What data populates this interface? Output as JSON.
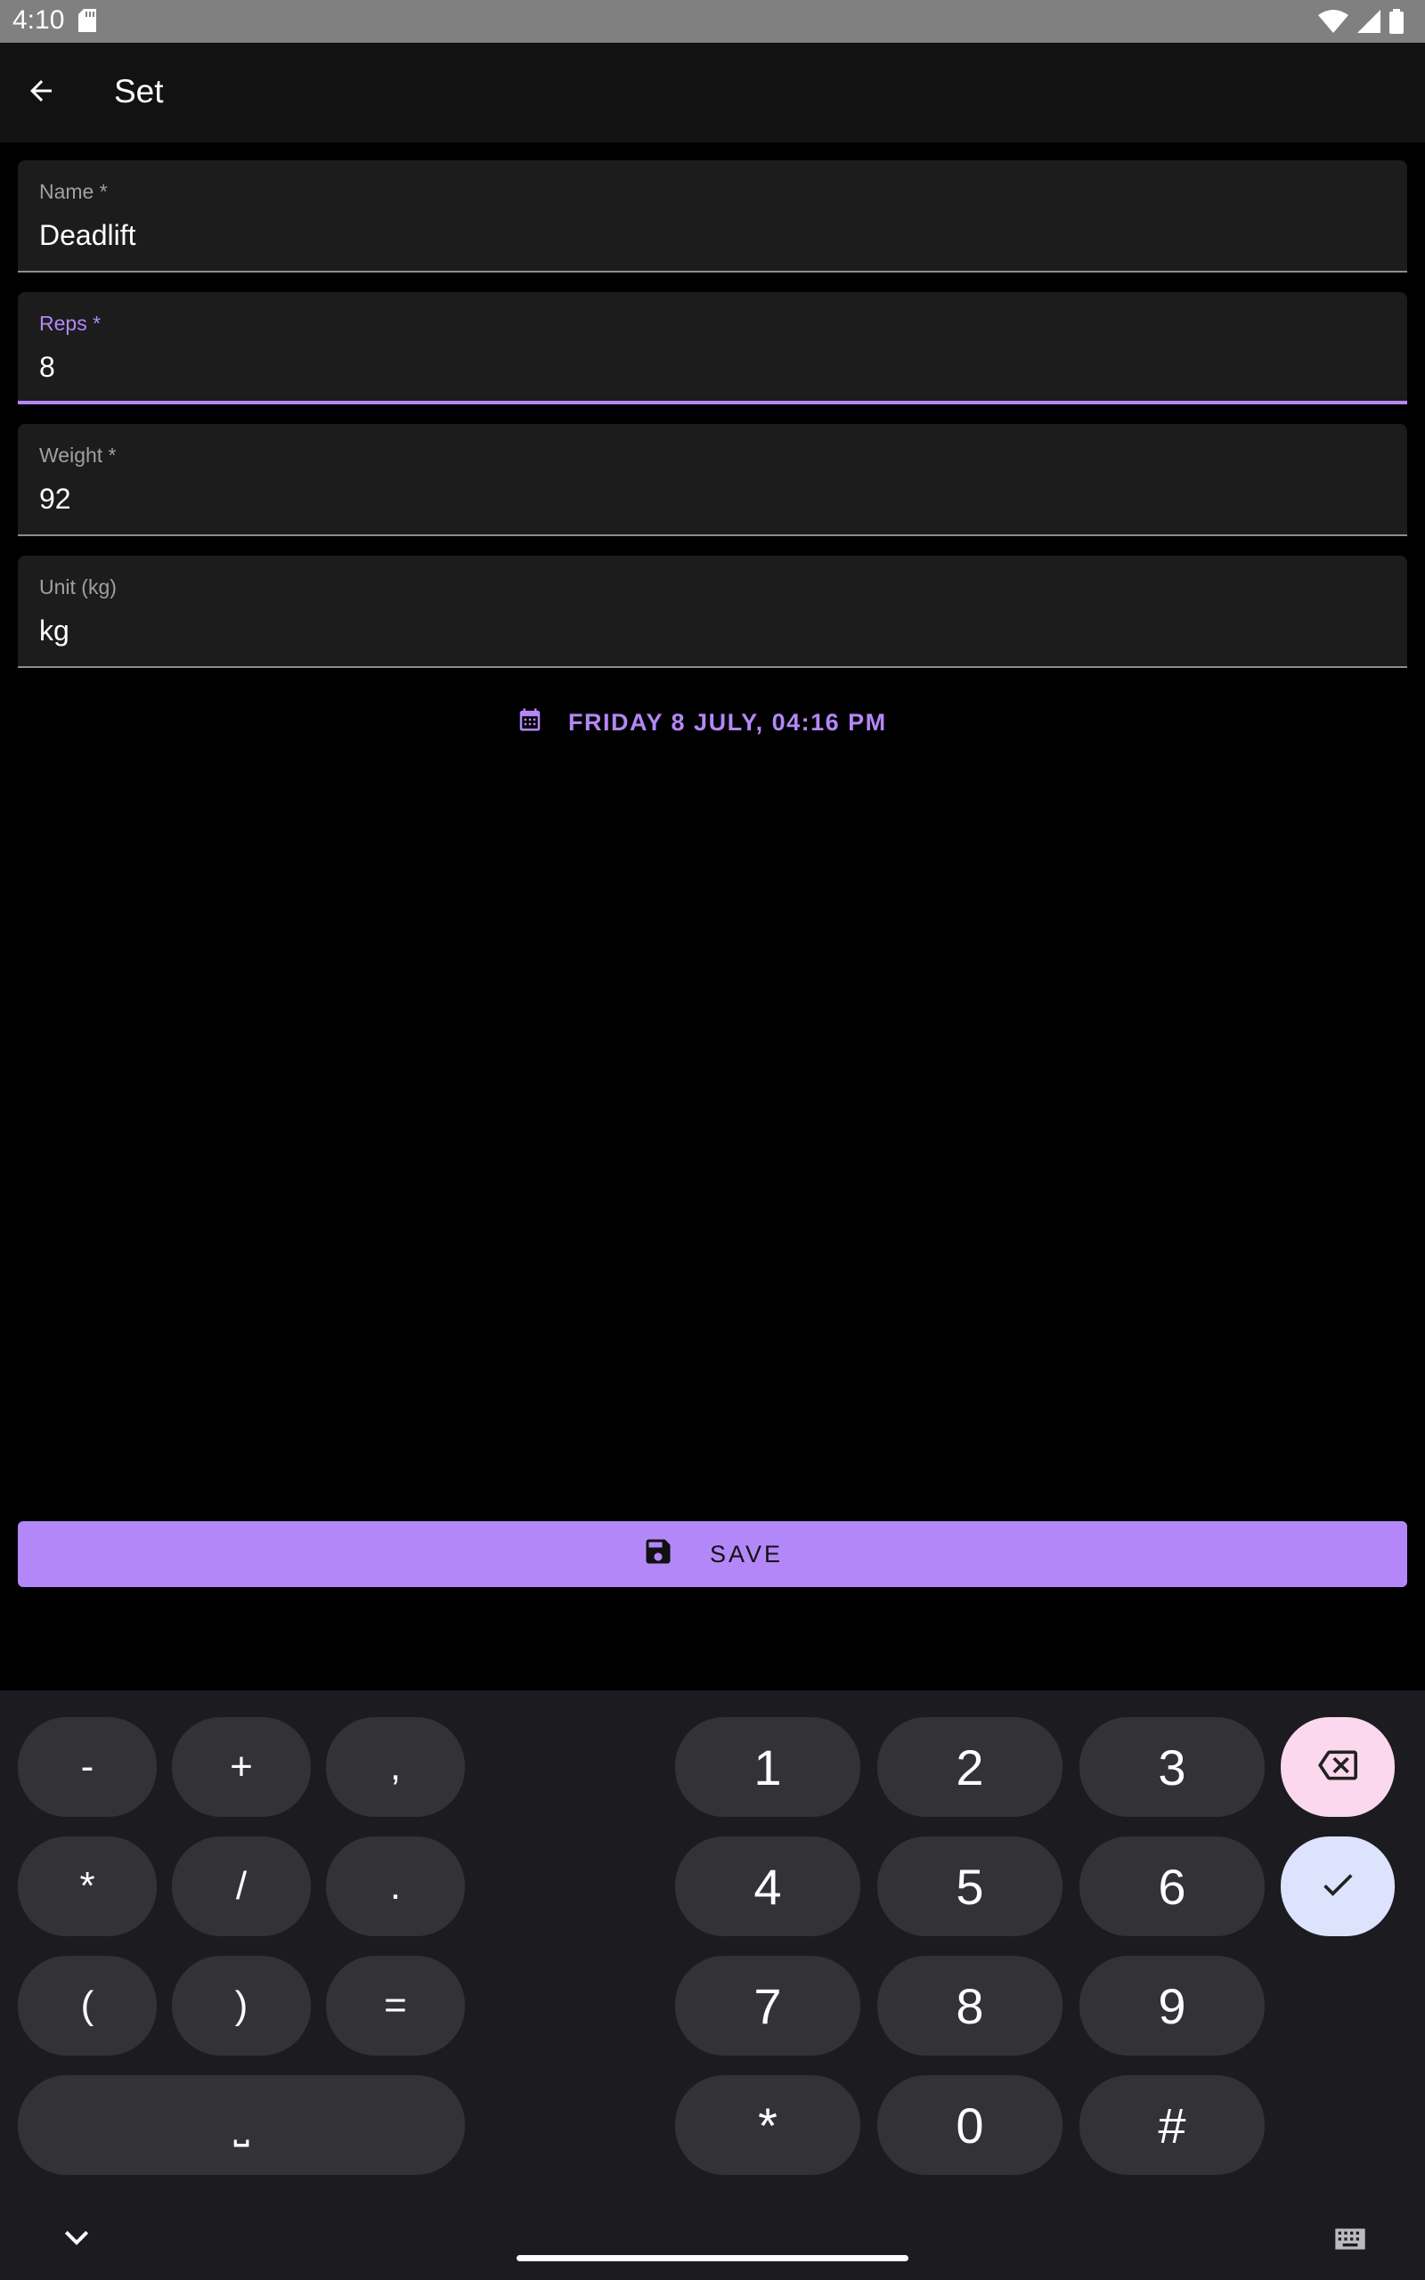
{
  "status_bar": {
    "time": "4:10"
  },
  "app_bar": {
    "title": "Set"
  },
  "fields": [
    {
      "label": "Name *",
      "value": "Deadlift",
      "focused": false
    },
    {
      "label": "Reps *",
      "value": "8",
      "focused": true
    },
    {
      "label": "Weight *",
      "value": "92",
      "focused": false
    },
    {
      "label": "Unit (kg)",
      "value": "kg",
      "focused": false
    }
  ],
  "date_button": {
    "label": "FRIDAY 8 JULY, 04:16 PM",
    "icon": "calendar-icon"
  },
  "save_button": {
    "label": "SAVE",
    "icon": "floppy-disk-icon"
  },
  "keyboard": {
    "symbol_keys": [
      "-",
      "+",
      ",",
      "*",
      "/",
      ".",
      "(",
      ")",
      "="
    ],
    "space_key": "⎵",
    "number_keys": [
      "1",
      "2",
      "3",
      "4",
      "5",
      "6",
      "7",
      "8",
      "9",
      "*",
      "0",
      "#"
    ],
    "backspace_icon": "backspace-icon",
    "enter_icon": "check-icon"
  },
  "colors": {
    "accent": "#b487f8",
    "background": "#000000",
    "surface": "#1c1c1c",
    "appbar": "#121212",
    "status_bar": "#808080",
    "keyboard_bg": "#1c1b20",
    "key_bg": "#333237",
    "backspace_bg": "#fbd8ee",
    "enter_bg": "#dde3fc"
  }
}
